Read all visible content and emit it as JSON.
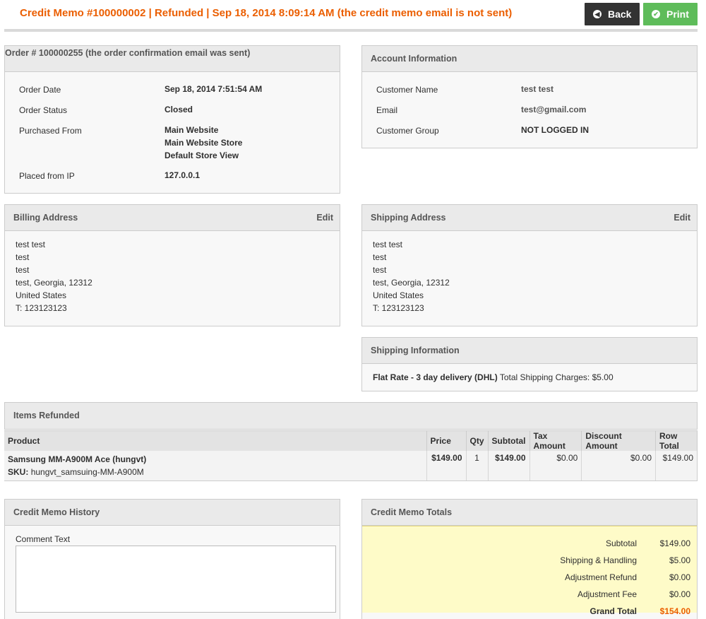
{
  "header": {
    "title": "Credit Memo #100000002 | Refunded | Sep 18, 2014 8:09:14 AM (the credit memo email is not sent)",
    "back_label": "Back",
    "print_label": "Print"
  },
  "order": {
    "title": "Order # 100000255 (the order confirmation email was sent)",
    "date_label": "Order Date",
    "date": "Sep 18, 2014 7:51:54 AM",
    "status_label": "Order Status",
    "status": "Closed",
    "purchased_label": "Purchased From",
    "purchased_1": "Main Website",
    "purchased_2": "Main Website Store",
    "purchased_3": "Default Store View",
    "ip_label": "Placed from IP",
    "ip": "127.0.0.1"
  },
  "account": {
    "title": "Account Information",
    "name_label": "Customer Name",
    "name": "test test",
    "email_label": "Email",
    "email": "test@gmail.com",
    "group_label": "Customer Group",
    "group": "NOT LOGGED IN"
  },
  "billing": {
    "title": "Billing Address",
    "edit": "Edit",
    "line1": "test test",
    "line2": "test",
    "line3": "test",
    "line4": "test, Georgia, 12312",
    "line5": "United States",
    "line6": "T: 123123123"
  },
  "shipping": {
    "title": "Shipping Address",
    "edit": "Edit",
    "line1": "test test",
    "line2": "test",
    "line3": "test",
    "line4": "test, Georgia, 12312",
    "line5": "United States",
    "line6": "T: 123123123"
  },
  "shipping_info": {
    "title": "Shipping Information",
    "method": "Flat Rate - 3 day delivery (DHL)",
    "charges": "Total Shipping Charges: $5.00"
  },
  "items": {
    "title": "Items Refunded",
    "headers": [
      "Product",
      "Price",
      "Qty",
      "Subtotal",
      "Tax Amount",
      "Discount Amount",
      "Row Total"
    ],
    "row": {
      "name": "Samsung MM-A900M Ace (hungvt)",
      "sku_label": "SKU:",
      "sku": "hungvt_samsuing-MM-A900M",
      "price": "$149.00",
      "qty": "1",
      "subtotal": "$149.00",
      "tax": "$0.00",
      "discount": "$0.00",
      "row_total": "$149.00"
    }
  },
  "history": {
    "title": "Credit Memo History",
    "comment_label": "Comment Text"
  },
  "totals": {
    "title": "Credit Memo Totals",
    "subtotal_label": "Subtotal",
    "subtotal": "$149.00",
    "shipping_label": "Shipping & Handling",
    "shipping": "$5.00",
    "adj_refund_label": "Adjustment Refund",
    "adj_refund": "$0.00",
    "adj_fee_label": "Adjustment Fee",
    "adj_fee": "$0.00",
    "grand_label": "Grand Total",
    "grand": "$154.00"
  },
  "colors": {
    "accent": "#eb5e00",
    "back_button": "#333333",
    "print_button": "#5ebc5a",
    "totals_bg": "#fefbc8"
  },
  "icons": {
    "back": "arrow-left-circle-icon",
    "print": "checkmark-circle-icon"
  }
}
